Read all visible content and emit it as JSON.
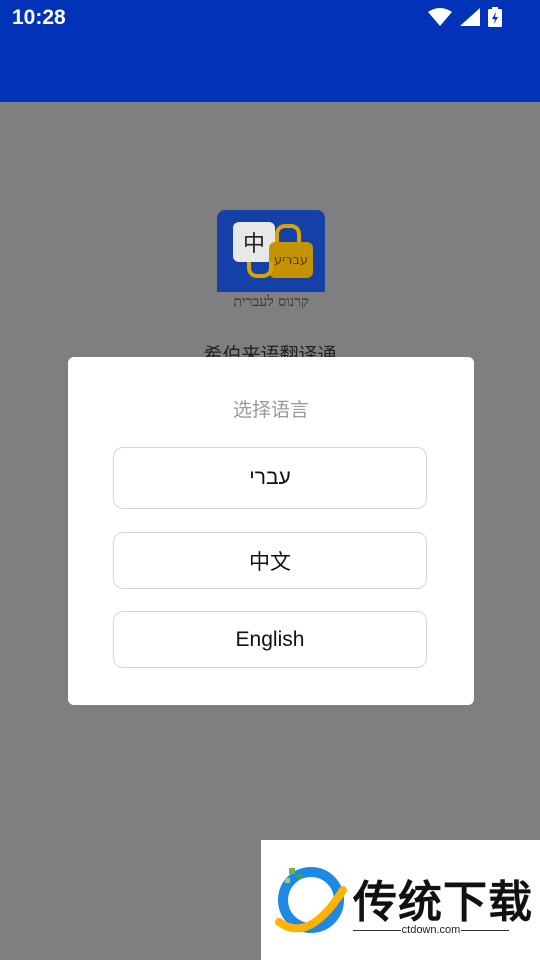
{
  "status_bar": {
    "time": "10:28",
    "icons": [
      "wifi-icon",
      "signal-icon",
      "battery-charging-icon"
    ],
    "color": "#0033b8"
  },
  "background_app": {
    "icon_zh": "中",
    "icon_he": "עבריע",
    "icon_caption": "קרנוס לעברית",
    "app_name": "希伯来语翻译通"
  },
  "dialog": {
    "title": "选择语言",
    "options": [
      "עברי",
      "中文",
      "English"
    ]
  },
  "watermark": {
    "brand": "传统下载",
    "url": "ctdown.com"
  }
}
